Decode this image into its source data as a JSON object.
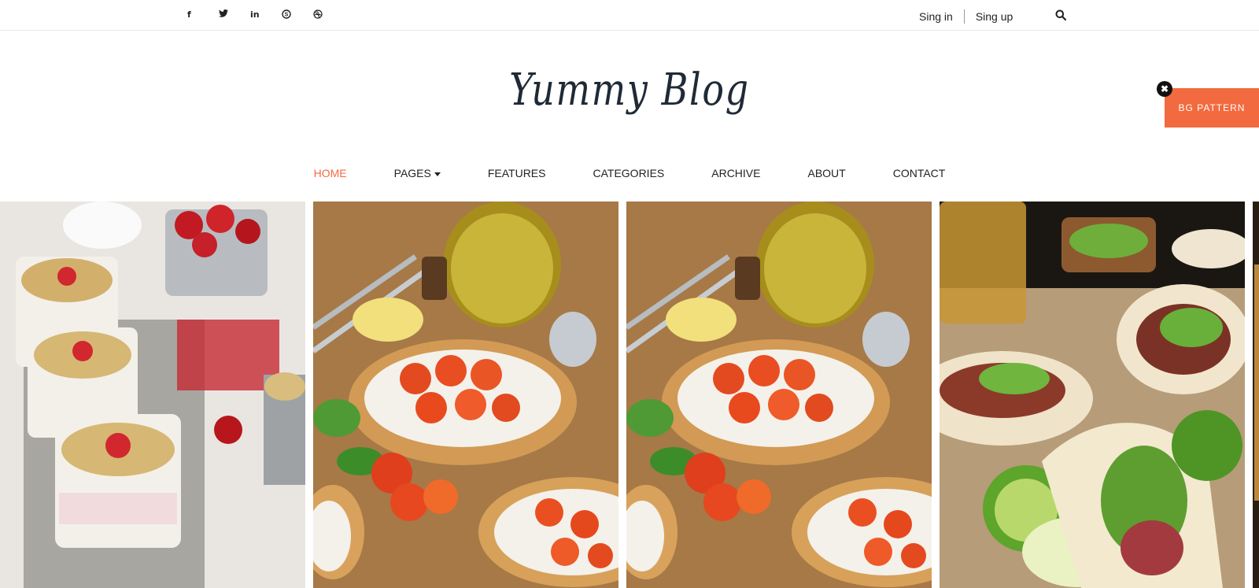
{
  "topbar": {
    "social": [
      {
        "name": "facebook-icon",
        "glyph": "f"
      },
      {
        "name": "twitter-icon",
        "glyph": "t"
      },
      {
        "name": "linkedin-icon",
        "glyph": "in"
      },
      {
        "name": "skype-icon",
        "glyph": "S"
      },
      {
        "name": "dribbble-icon",
        "glyph": "◎"
      }
    ],
    "signin": "Sing in",
    "signup": "Sing up",
    "search_icon": "search-icon"
  },
  "logo": "Yummy Blog",
  "bg_pattern": "BG PATTERN",
  "nav": [
    {
      "label": "HOME",
      "active": true
    },
    {
      "label": "PAGES",
      "dropdown": true
    },
    {
      "label": "FEATURES"
    },
    {
      "label": "CATEGORIES"
    },
    {
      "label": "ARCHIVE"
    },
    {
      "label": "ABOUT"
    },
    {
      "label": "CONTACT"
    }
  ],
  "colors": {
    "accent": "#f26a3f",
    "text": "#222222",
    "logo": "#1f2a36"
  }
}
